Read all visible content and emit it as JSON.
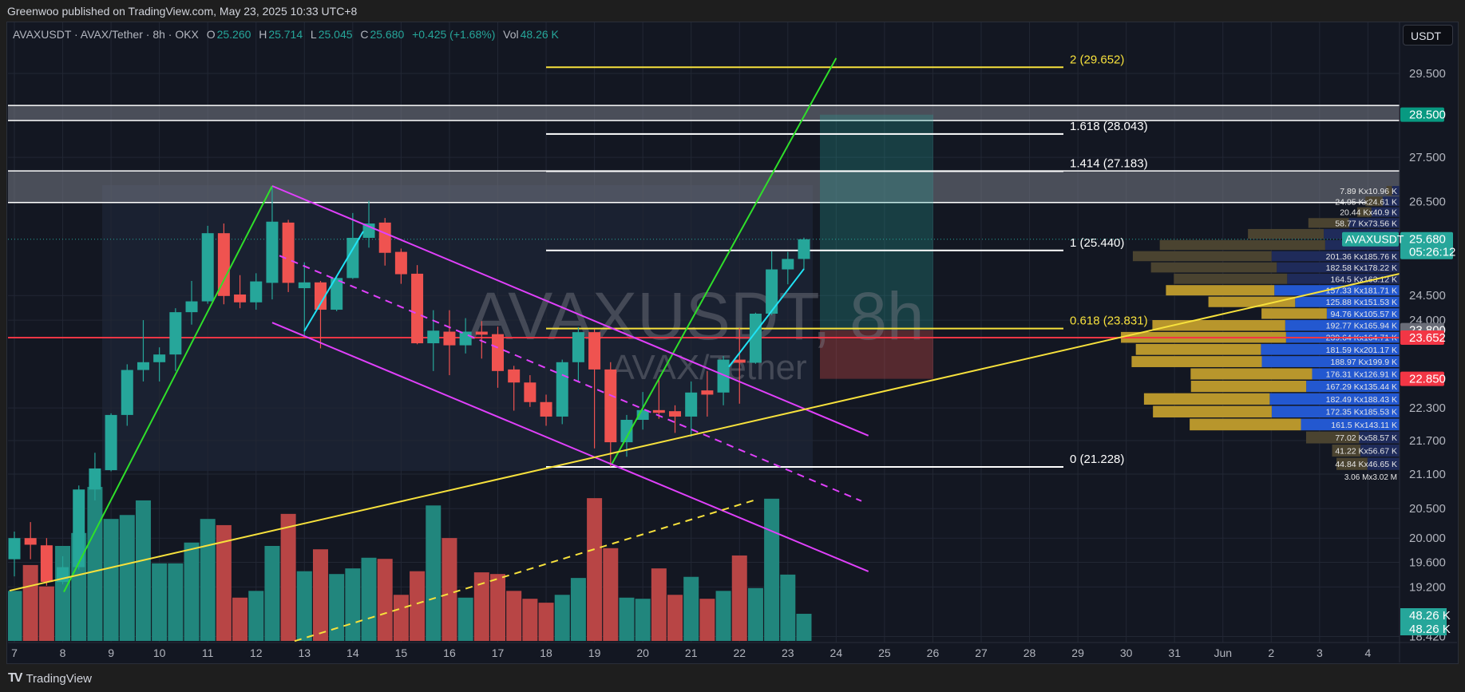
{
  "published": "Greenwoo published on TradingView.com, May 23, 2025 10:33 UTC+8",
  "legend": {
    "symbol": "AVAXUSDT · AVAX/Tether · 8h · OKX",
    "o_label": "O",
    "o": "25.260",
    "h_label": "H",
    "h": "25.714",
    "l_label": "L",
    "l": "25.045",
    "c_label": "C",
    "c": "25.680",
    "change": "+0.425 (+1.68%)",
    "vol_label": "Vol",
    "vol": "48.26 K"
  },
  "currency_button": "USDT",
  "footer": {
    "logo": "TV",
    "brand": "TradingView"
  },
  "colors": {
    "up": "#26a69a",
    "down": "#ef5350",
    "vol_up": "#21867d",
    "vol_down": "#b84545",
    "fib_yellow": "#f7e13c",
    "magenta": "#e040fb",
    "green_line": "#2fe02a",
    "cyan": "#20e3f5",
    "poc_red": "#f23645"
  },
  "chart_data": {
    "type": "candlestick",
    "title": "AVAXUSDT, 8h",
    "subtitle": "AVAX/Tether",
    "scale": "log",
    "ylim": [
      18.35,
      30.2
    ],
    "x_tick_labels": [
      "7",
      "8",
      "9",
      "10",
      "11",
      "12",
      "13",
      "14",
      "15",
      "16",
      "17",
      "18",
      "19",
      "20",
      "21",
      "22",
      "23",
      "24",
      "25",
      "26",
      "27",
      "28",
      "29",
      "30",
      "31",
      "Jun",
      "2",
      "3",
      "4"
    ],
    "y_tick_labels": [
      29.5,
      27.5,
      26.5,
      24.5,
      24.0,
      22.3,
      21.7,
      21.1,
      20.5,
      20.0,
      19.6,
      19.2,
      18.42
    ],
    "y_tick_text": [
      "29.500",
      "27.500",
      "26.500",
      "24.500",
      "24.000",
      "22.300",
      "21.700",
      "21.100",
      "20.500",
      "20.000",
      "19.600",
      "19.200",
      "18.420"
    ],
    "candles_ohlc": [
      [
        19.65,
        20.11,
        19.37,
        20.0
      ],
      [
        20.0,
        20.27,
        19.65,
        19.89
      ],
      [
        19.88,
        20.0,
        19.22,
        19.28
      ],
      [
        19.28,
        19.7,
        19.24,
        19.52
      ],
      [
        19.52,
        20.9,
        19.48,
        20.83
      ],
      [
        20.83,
        21.48,
        20.64,
        21.2
      ],
      [
        21.17,
        22.2,
        21.15,
        22.17
      ],
      [
        22.17,
        23.13,
        21.97,
        23.02
      ],
      [
        23.02,
        24.0,
        22.8,
        23.17
      ],
      [
        23.17,
        23.46,
        22.8,
        23.32
      ],
      [
        23.32,
        24.24,
        23.0,
        24.16
      ],
      [
        24.16,
        24.8,
        23.91,
        24.38
      ],
      [
        24.38,
        25.97,
        24.33,
        25.81
      ],
      [
        25.81,
        26.02,
        24.32,
        24.49
      ],
      [
        24.52,
        24.92,
        24.24,
        24.36
      ],
      [
        24.36,
        24.96,
        24.21,
        24.79
      ],
      [
        24.76,
        26.85,
        24.42,
        26.06
      ],
      [
        26.04,
        26.1,
        24.57,
        24.76
      ],
      [
        24.65,
        25.19,
        23.7,
        24.77
      ],
      [
        24.77,
        24.8,
        23.44,
        24.21
      ],
      [
        24.21,
        24.9,
        24.18,
        24.86
      ],
      [
        24.86,
        26.25,
        24.84,
        25.71
      ],
      [
        25.71,
        26.52,
        25.5,
        26.02
      ],
      [
        26.04,
        26.14,
        25.12,
        25.39
      ],
      [
        25.41,
        25.48,
        24.74,
        24.94
      ],
      [
        24.95,
        25.13,
        23.52,
        23.54
      ],
      [
        23.54,
        24.2,
        23.0,
        23.79
      ],
      [
        23.77,
        24.2,
        22.92,
        23.5
      ],
      [
        23.5,
        24.04,
        23.34,
        23.77
      ],
      [
        23.77,
        23.98,
        23.24,
        23.71
      ],
      [
        23.72,
        23.87,
        22.68,
        23.0
      ],
      [
        23.03,
        23.1,
        22.25,
        22.78
      ],
      [
        22.78,
        22.92,
        22.32,
        22.41
      ],
      [
        22.41,
        22.55,
        21.97,
        22.14
      ],
      [
        22.14,
        23.22,
        22.0,
        23.17
      ],
      [
        23.17,
        23.86,
        22.8,
        23.76
      ],
      [
        23.76,
        23.82,
        21.56,
        23.03
      ],
      [
        23.03,
        23.17,
        21.23,
        21.67
      ],
      [
        21.67,
        22.17,
        21.41,
        22.08
      ],
      [
        22.08,
        22.6,
        21.9,
        22.26
      ],
      [
        22.26,
        22.84,
        22.1,
        22.21
      ],
      [
        22.24,
        22.35,
        21.84,
        22.14
      ],
      [
        22.14,
        22.8,
        21.77,
        22.59
      ],
      [
        22.63,
        23.0,
        22.14,
        22.55
      ],
      [
        22.59,
        23.29,
        22.35,
        23.22
      ],
      [
        23.22,
        23.84,
        22.38,
        23.16
      ],
      [
        23.16,
        24.15,
        23.14,
        24.13
      ],
      [
        24.13,
        25.42,
        24.1,
        25.04
      ],
      [
        25.04,
        25.41,
        24.73,
        25.26
      ],
      [
        25.26,
        25.714,
        25.045,
        25.68
      ]
    ],
    "volumes_k": [
      89,
      135,
      97,
      169,
      192,
      274,
      217,
      224,
      250,
      138,
      138,
      175,
      217,
      206,
      77,
      89,
      169,
      226,
      124,
      163,
      119,
      129,
      148,
      146,
      82,
      124,
      241,
      183,
      77,
      122,
      119,
      89,
      75,
      68,
      82,
      112,
      254,
      165,
      77,
      75,
      129,
      82,
      114,
      75,
      89,
      152,
      94,
      253,
      118,
      48.26
    ],
    "current_price": {
      "value": 25.68,
      "symbol_label": "AVAXUSDT",
      "price_label": "25.680",
      "countdown": "05:26:12"
    },
    "volume_labels": [
      "48.26 K",
      "48.26 K"
    ],
    "fib": [
      {
        "label": "2 (29.652)",
        "price": 29.652,
        "color": "#f7e13c"
      },
      {
        "label": "1.618 (28.043)",
        "price": 28.043,
        "color": "#ffffff"
      },
      {
        "label": "1.414 (27.183)",
        "price": 27.183,
        "color": "#ffffff"
      },
      {
        "label": "1 (25.440)",
        "price": 25.44,
        "color": "#ffffff"
      },
      {
        "label": "0.618 (23.831)",
        "price": 23.831,
        "color": "#f7e13c"
      },
      {
        "label": "0 (21.228)",
        "price": 21.228,
        "color": "#ffffff"
      }
    ],
    "resistance_zones": [
      [
        28.36,
        28.72
      ],
      [
        26.48,
        27.19
      ]
    ],
    "horizontal_line": {
      "price": 23.652,
      "label": "23.652"
    },
    "long_position": {
      "entry": 23.8,
      "target": 28.5,
      "stop": 22.85,
      "entry_label": "23.800",
      "target_label": "28.500",
      "stop_label": "22.850"
    },
    "trendlines": [
      {
        "name": "green-trendline",
        "color": "#2fe02a",
        "dash": false,
        "from": [
          3.07,
          19.12
        ],
        "to": [
          16.0,
          26.85
        ]
      },
      {
        "name": "green-trendline",
        "color": "#2fe02a",
        "dash": false,
        "from": [
          37.06,
          21.27
        ],
        "to": [
          51.0,
          29.88
        ]
      },
      {
        "name": "channel-upper",
        "color": "#e040fb",
        "dash": false,
        "from": [
          16.0,
          26.85
        ],
        "to": [
          53.0,
          21.79
        ]
      },
      {
        "name": "channel-lower",
        "color": "#e040fb",
        "dash": false,
        "from": [
          16.0,
          23.95
        ],
        "to": [
          53.0,
          19.45
        ]
      },
      {
        "name": "channel-mid",
        "color": "#e040fb",
        "dash": true,
        "from": [
          16.45,
          25.33
        ],
        "to": [
          52.57,
          20.63
        ]
      },
      {
        "name": "cyan-trendline",
        "color": "#20e3f5",
        "dash": false,
        "from": [
          17.99,
          23.78
        ],
        "to": [
          21.65,
          25.85
        ]
      },
      {
        "name": "cyan-trendline",
        "color": "#20e3f5",
        "dash": false,
        "from": [
          44.34,
          23.08
        ],
        "to": [
          49.0,
          25.05
        ]
      },
      {
        "name": "yellow-support",
        "color": "#f7e13c",
        "dash": false,
        "from": [
          -0.3,
          19.14
        ],
        "to": [
          85.96,
          24.95
        ]
      },
      {
        "name": "yellow-dashed",
        "color": "#f7e13c",
        "dash": true,
        "from": [
          17.39,
          18.35
        ],
        "to": [
          45.98,
          20.65
        ]
      }
    ],
    "volume_profile": {
      "bin_top": 26.85,
      "bin_size": 0.2374,
      "rows": [
        {
          "buy": 7.89,
          "sell": 10.96,
          "label": "7.89 Kx10.96 K",
          "in_value_area": false
        },
        {
          "buy": 24.95,
          "sell": 24.61,
          "label": "24.95 Kx24.61 K",
          "in_value_area": false
        },
        {
          "buy": 20.44,
          "sell": 40.9,
          "label": "20.44 Kx40.9 K",
          "in_value_area": false
        },
        {
          "buy": 58.77,
          "sell": 73.56,
          "label": "58.77 Kx73.56 K",
          "in_value_area": false
        },
        {
          "buy": 110,
          "sell": 110,
          "label": "",
          "in_value_area": false
        },
        {
          "buy": 240,
          "sell": 108,
          "label": "",
          "in_value_area": false
        },
        {
          "buy": 201.36,
          "sell": 185.76,
          "label": "201.36 Kx185.76 K",
          "in_value_area": false
        },
        {
          "buy": 182.58,
          "sell": 178.22,
          "label": "182.58 Kx178.22 K",
          "in_value_area": false
        },
        {
          "buy": 164.5,
          "sell": 163.12,
          "label": "164.5 Kx163.12 K",
          "in_value_area": false
        },
        {
          "buy": 157.33,
          "sell": 181.71,
          "label": "157.33 Kx181.71 K",
          "in_value_area": true
        },
        {
          "buy": 125.88,
          "sell": 151.53,
          "label": "125.88 Kx151.53 K",
          "in_value_area": true
        },
        {
          "buy": 94.76,
          "sell": 105.57,
          "label": "94.76 Kx105.57 K",
          "in_value_area": true
        },
        {
          "buy": 192.77,
          "sell": 165.94,
          "label": "192.77 Kx165.94 K",
          "in_value_area": true
        },
        {
          "buy": 239.64,
          "sell": 164.71,
          "label": "239.64 Kx164.71 K",
          "in_value_area": true
        },
        {
          "buy": 181.59,
          "sell": 201.17,
          "label": "181.59 Kx201.17 K",
          "in_value_area": true
        },
        {
          "buy": 188.97,
          "sell": 199.9,
          "label": "188.97 Kx199.9 K",
          "in_value_area": true
        },
        {
          "buy": 176.31,
          "sell": 126.91,
          "label": "176.31 Kx126.91 K",
          "in_value_area": true
        },
        {
          "buy": 167.29,
          "sell": 135.44,
          "label": "167.29 Kx135.44 K",
          "in_value_area": true
        },
        {
          "buy": 182.49,
          "sell": 188.43,
          "label": "182.49 Kx188.43 K",
          "in_value_area": true
        },
        {
          "buy": 172.35,
          "sell": 185.53,
          "label": "172.35 Kx185.53 K",
          "in_value_area": true
        },
        {
          "buy": 161.5,
          "sell": 143.11,
          "label": "161.5 Kx143.11 K",
          "in_value_area": true
        },
        {
          "buy": 77.02,
          "sell": 58.57,
          "label": "77.02 Kx58.57 K",
          "in_value_area": false
        },
        {
          "buy": 41.22,
          "sell": 56.67,
          "label": "41.22 Kx56.67 K",
          "in_value_area": false
        },
        {
          "buy": 44.84,
          "sell": 46.65,
          "label": "44.84 Kx46.65 K",
          "in_value_area": false
        }
      ],
      "total_label": "3.06 Mx3.02 M"
    }
  }
}
